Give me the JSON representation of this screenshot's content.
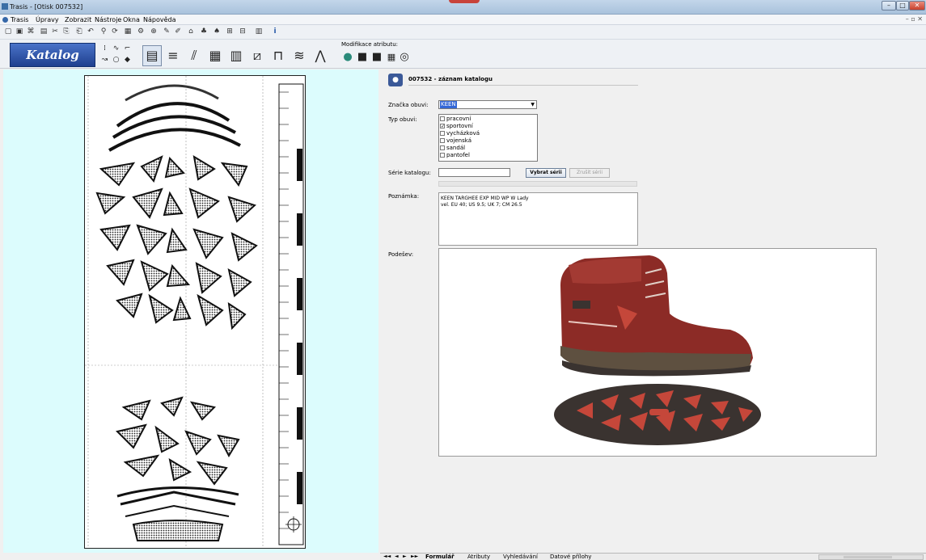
{
  "window": {
    "title": "Trasis - [Otisk 007532]",
    "min": "–",
    "max": "□",
    "close": "✕"
  },
  "menu": {
    "items": [
      "Trasis",
      "Úpravy",
      "Zobrazit",
      "Nástroje",
      "Okna",
      "Nápověda"
    ],
    "mdi_controls": "– ▫ ✕"
  },
  "toolbar": {
    "icons": [
      "new-file",
      "open-folder",
      "save",
      "print",
      "cut",
      "copy",
      "paste",
      "undo",
      "find",
      "refresh",
      "grid",
      "settings",
      "zoom",
      "brush",
      "pen",
      "tag",
      "tree",
      "tree-alt",
      "zoom-in",
      "zoom-out",
      "layout",
      "info"
    ],
    "glyphs": [
      "▢",
      "▣",
      "⌘",
      "▤",
      "✂",
      "⎘",
      "⎗",
      "↶",
      "⚲",
      "⟳",
      "▦",
      "⚙",
      "⊕",
      "✎",
      "✐",
      "⌂",
      "♣",
      "♠",
      "⊞",
      "⊟",
      "▥",
      "i"
    ]
  },
  "catalog": {
    "label": "Katalog"
  },
  "patterns": {
    "glyphs": [
      "▤",
      "≡",
      "⫽",
      "▦",
      "▥",
      "⧄",
      "⊓",
      "≋",
      "⋀"
    ],
    "selected_index": 0
  },
  "small_tools": {
    "glyphs": [
      "⁞",
      "∿",
      "⌐",
      "↝",
      "○",
      "◆"
    ]
  },
  "modifier": {
    "label": "Modifikace atributu:",
    "glyphs": [
      "●",
      "■",
      "■",
      "▦",
      "◎"
    ]
  },
  "record": {
    "title": "007532 - záznam katalogu",
    "icon": "record-icon"
  },
  "form": {
    "brand_label": "Značka obuvi:",
    "brand_value": "KEEN",
    "type_label": "Typ obuvi:",
    "types": [
      {
        "label": "pracovní",
        "checked": false
      },
      {
        "label": "sportovní",
        "checked": true
      },
      {
        "label": "vycházková",
        "checked": false
      },
      {
        "label": "vojenská",
        "checked": false
      },
      {
        "label": "sandál",
        "checked": false
      },
      {
        "label": "pantofel",
        "checked": false
      }
    ],
    "series_label": "Série katalogu:",
    "series_value": "",
    "select_button": "Vybrat sérii",
    "cancel_button": "Zrušit sérii",
    "note_label": "Poznámka:",
    "note_line1": "KEEN TARGHEE EXP MID WP W Lady",
    "note_line2": "vel. EU 40; US 9.5; UK 7; CM 26.5",
    "sole_label": "Podešev:"
  },
  "colors": {
    "shoe_red": "#8c2b26",
    "rubber": "#3a3330",
    "accent": "#c5473a",
    "left_bg": "#dcfcfd"
  },
  "bottom": {
    "nav": [
      "◄◄",
      "◄",
      "►",
      "►►"
    ],
    "tabs": [
      "Formulář",
      "Atributy",
      "Vyhledávání",
      "Datové přílohy"
    ]
  }
}
